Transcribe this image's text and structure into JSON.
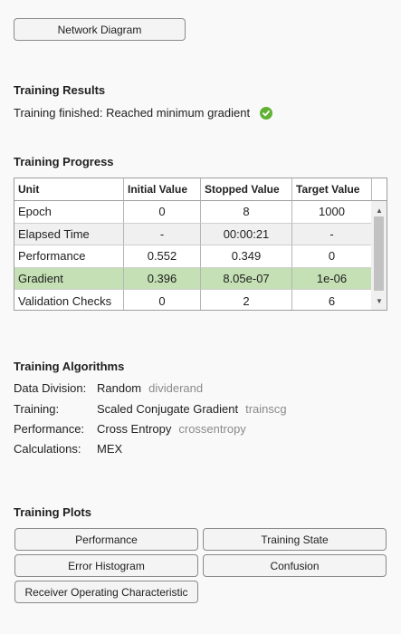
{
  "network_diagram_button": "Network Diagram",
  "results": {
    "heading": "Training Results",
    "status_text": "Training finished: Reached minimum gradient"
  },
  "progress": {
    "heading": "Training Progress",
    "columns": [
      "Unit",
      "Initial Value",
      "Stopped Value",
      "Target Value"
    ],
    "rows": [
      {
        "unit": "Epoch",
        "initial": "0",
        "stopped": "8",
        "target": "1000"
      },
      {
        "unit": "Elapsed Time",
        "initial": "-",
        "stopped": "00:00:21",
        "target": "-"
      },
      {
        "unit": "Performance",
        "initial": "0.552",
        "stopped": "0.349",
        "target": "0"
      },
      {
        "unit": "Gradient",
        "initial": "0.396",
        "stopped": "8.05e-07",
        "target": "1e-06"
      },
      {
        "unit": "Validation Checks",
        "initial": "0",
        "stopped": "2",
        "target": "6"
      }
    ],
    "highlight_color": "#c4e0b4"
  },
  "algorithms": {
    "heading": "Training Algorithms",
    "items": [
      {
        "label": "Data Division:",
        "value": "Random",
        "fn": "dividerand"
      },
      {
        "label": "Training:",
        "value": "Scaled Conjugate Gradient",
        "fn": "trainscg"
      },
      {
        "label": "Performance:",
        "value": "Cross Entropy",
        "fn": "crossentropy"
      },
      {
        "label": "Calculations:",
        "value": "MEX",
        "fn": ""
      }
    ]
  },
  "plots": {
    "heading": "Training Plots",
    "buttons": [
      "Performance",
      "Training State",
      "Error Histogram",
      "Confusion",
      "Receiver Operating Characteristic"
    ]
  },
  "icons": {
    "status": "check-circle-icon",
    "scroll_up": "scroll-up-arrow-icon",
    "scroll_down": "scroll-down-arrow-icon"
  },
  "colors": {
    "success": "#61b135"
  }
}
